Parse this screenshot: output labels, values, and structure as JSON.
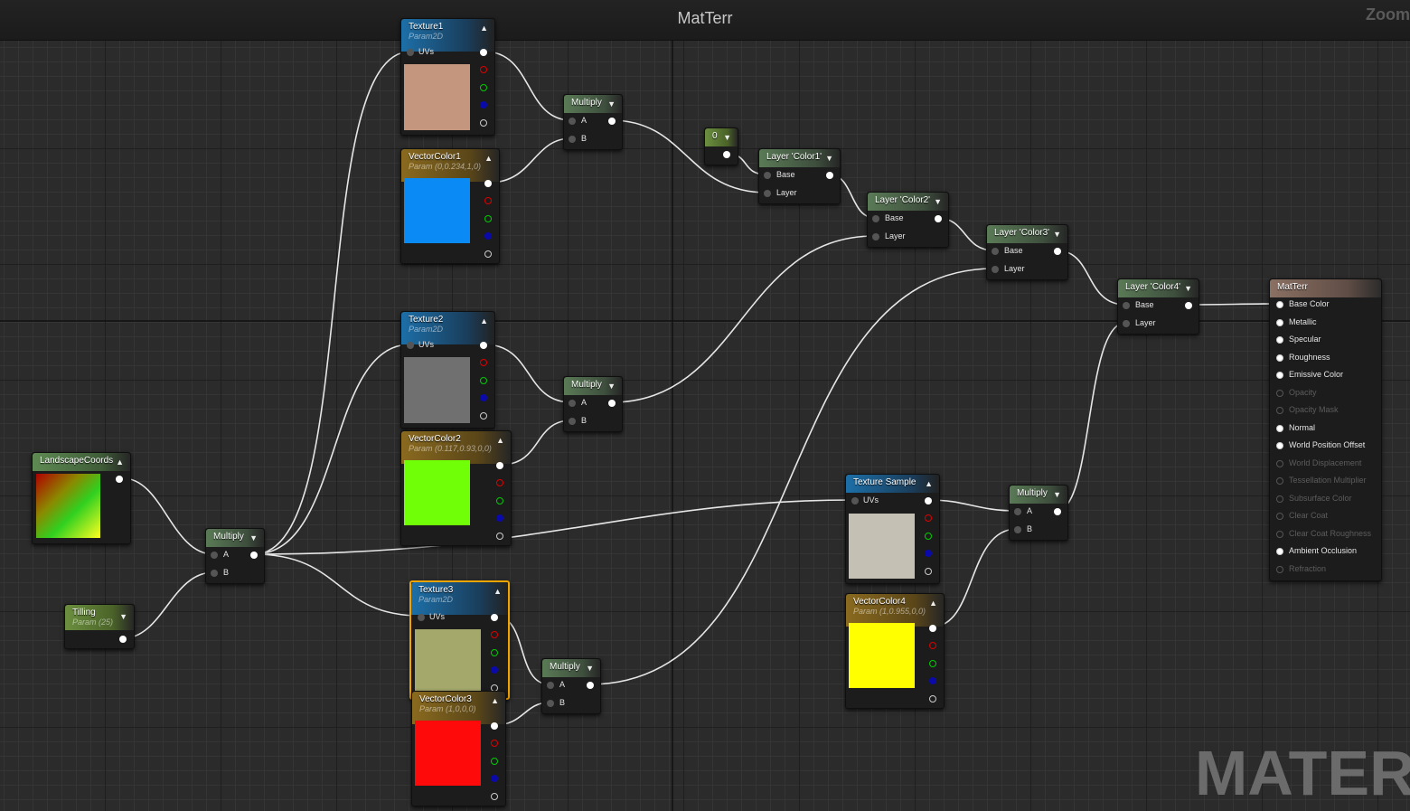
{
  "title": "MatTerr",
  "zoom_label": "Zoom",
  "watermark": "MATERIAL",
  "colors": {
    "texture1": "#c4967e",
    "vector1": "#0a8af5",
    "texture2": "#707070",
    "vector2": "#70ff07",
    "texture3": "#a5a86b",
    "vector3": "#ff0a0a",
    "texture_sample": "#c4c0b4",
    "vector4": "#ffff00"
  },
  "nodes": {
    "texture1": {
      "title": "Texture1",
      "sub": "Param2D",
      "uvs": "UVs"
    },
    "vector1": {
      "title": "VectorColor1",
      "sub": "Param (0,0.234,1,0)"
    },
    "multiply1": {
      "title": "Multiply",
      "a": "A",
      "b": "B"
    },
    "const0": {
      "title": "0"
    },
    "layer1": {
      "title": "Layer 'Color1'",
      "base": "Base",
      "layer": "Layer"
    },
    "layer2": {
      "title": "Layer 'Color2'",
      "base": "Base",
      "layer": "Layer"
    },
    "layer3": {
      "title": "Layer 'Color3'",
      "base": "Base",
      "layer": "Layer"
    },
    "layer4": {
      "title": "Layer 'Color4'",
      "base": "Base",
      "layer": "Layer"
    },
    "texture2": {
      "title": "Texture2",
      "sub": "Param2D",
      "uvs": "UVs"
    },
    "vector2": {
      "title": "VectorColor2",
      "sub": "Param (0.117,0.93,0,0)"
    },
    "multiply2": {
      "title": "Multiply",
      "a": "A",
      "b": "B"
    },
    "landscape": {
      "title": "LandscapeCoords"
    },
    "multiply_main": {
      "title": "Multiply",
      "a": "A",
      "b": "B"
    },
    "tilling": {
      "title": "Tilling",
      "sub": "Param (25)"
    },
    "texture3": {
      "title": "Texture3",
      "sub": "Param2D",
      "uvs": "UVs"
    },
    "vector3": {
      "title": "VectorColor3",
      "sub": "Param (1,0,0,0)"
    },
    "multiply3": {
      "title": "Multiply",
      "a": "A",
      "b": "B"
    },
    "texture_sample": {
      "title": "Texture Sample",
      "uvs": "UVs"
    },
    "vector4": {
      "title": "VectorColor4",
      "sub": "Param (1,0.955,0,0)"
    },
    "multiply4": {
      "title": "Multiply",
      "a": "A",
      "b": "B"
    },
    "result": {
      "title": "MatTerr",
      "inputs": [
        {
          "label": "Base Color",
          "active": true
        },
        {
          "label": "Metallic",
          "active": true
        },
        {
          "label": "Specular",
          "active": true
        },
        {
          "label": "Roughness",
          "active": true
        },
        {
          "label": "Emissive Color",
          "active": true
        },
        {
          "label": "Opacity",
          "active": false
        },
        {
          "label": "Opacity Mask",
          "active": false
        },
        {
          "label": "Normal",
          "active": true
        },
        {
          "label": "World Position Offset",
          "active": true
        },
        {
          "label": "World Displacement",
          "active": false
        },
        {
          "label": "Tessellation Multiplier",
          "active": false
        },
        {
          "label": "Subsurface Color",
          "active": false
        },
        {
          "label": "Clear Coat",
          "active": false
        },
        {
          "label": "Clear Coat Roughness",
          "active": false
        },
        {
          "label": "Ambient Occlusion",
          "active": true
        },
        {
          "label": "Refraction",
          "active": false
        }
      ]
    }
  }
}
